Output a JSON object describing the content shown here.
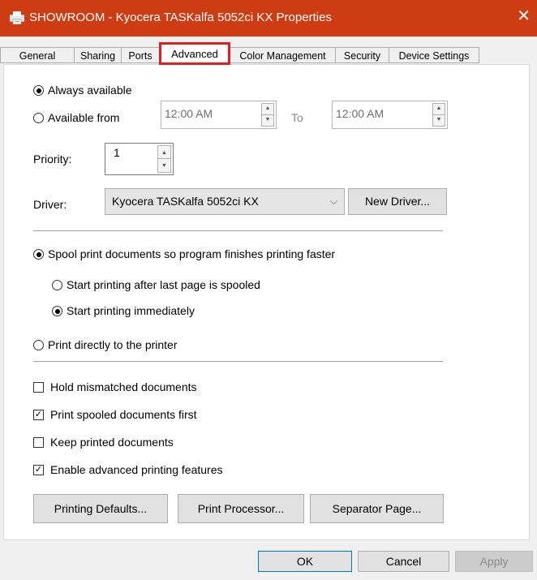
{
  "window": {
    "title": "SHOWROOM - Kyocera TASKalfa 5052ci KX Properties",
    "close_icon": "close-icon",
    "printer_icon": "printer-icon"
  },
  "tabs": [
    {
      "label": "General",
      "active": false
    },
    {
      "label": "Sharing",
      "active": false
    },
    {
      "label": "Ports",
      "active": false
    },
    {
      "label": "Advanced",
      "active": true
    },
    {
      "label": "Color Management",
      "active": false
    },
    {
      "label": "Security",
      "active": false
    },
    {
      "label": "Device Settings",
      "active": false
    }
  ],
  "availability": {
    "always_label": "Always available",
    "from_label": "Available from",
    "from_time": "12:00 AM",
    "to_label": "To",
    "to_time": "12:00 AM",
    "selected": "always"
  },
  "priority": {
    "label": "Priority:",
    "value": "1"
  },
  "driver": {
    "label": "Driver:",
    "selected": "Kyocera TASKalfa 5052ci KX",
    "new_driver_label": "New Driver..."
  },
  "spooling": {
    "spool_label": "Spool print documents so program finishes printing faster",
    "after_last_label": "Start printing after last page is spooled",
    "immediately_label": "Start printing immediately",
    "direct_label": "Print directly to the printer",
    "selected_mode": "spool",
    "selected_start": "immediately"
  },
  "options": [
    {
      "label": "Hold mismatched documents",
      "checked": false
    },
    {
      "label": "Print spooled documents first",
      "checked": true
    },
    {
      "label": "Keep printed documents",
      "checked": false
    },
    {
      "label": "Enable advanced printing features",
      "checked": true
    }
  ],
  "panel_buttons": {
    "defaults": "Printing Defaults...",
    "processor": "Print Processor...",
    "separator": "Separator Page..."
  },
  "dialog_buttons": {
    "ok": "OK",
    "cancel": "Cancel",
    "apply": "Apply"
  },
  "colors": {
    "titlebar": "#cd3c12",
    "highlight": "#e21d1d"
  }
}
